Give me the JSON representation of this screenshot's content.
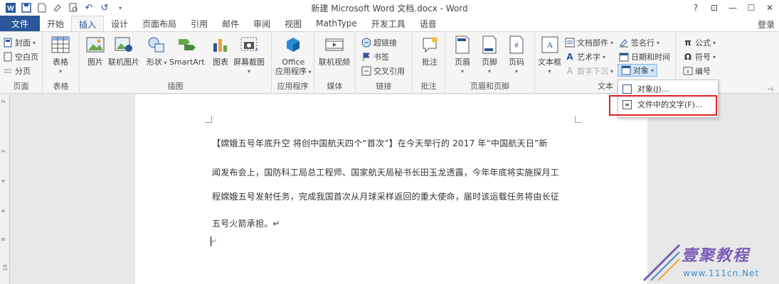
{
  "window": {
    "title": "新建 Microsoft Word 文档.docx - Word",
    "controls": [
      "?",
      "⊡",
      "—",
      "☐",
      "✕"
    ]
  },
  "qat": {
    "save": "💾",
    "undo": "↶",
    "redo": "↺"
  },
  "tabs": [
    "文件",
    "开始",
    "插入",
    "设计",
    "页面布局",
    "引用",
    "邮件",
    "审阅",
    "视图",
    "MathType",
    "开发工具",
    "语音"
  ],
  "active_tab": "插入",
  "login": "登录",
  "ribbon": {
    "pages": {
      "label": "页面",
      "cover": "封面",
      "blank": "空白页",
      "break": "分页"
    },
    "tables": {
      "label": "表格",
      "table": "表格"
    },
    "illustrations": {
      "label": "插图",
      "picture": "图片",
      "online_picture": "联机图片",
      "shapes": "形状",
      "smartart": "SmartArt",
      "chart": "图表",
      "screenshot": "屏幕截图"
    },
    "apps": {
      "label": "应用程序",
      "office_apps_1": "Office",
      "office_apps_2": "应用程序"
    },
    "media": {
      "label": "媒体",
      "online_video": "联机视频"
    },
    "links": {
      "label": "链接",
      "hyperlink": "超链接",
      "bookmark": "书签",
      "cross_ref": "交叉引用"
    },
    "comments": {
      "label": "批注",
      "comment": "批注"
    },
    "header_footer": {
      "label": "页眉和页脚",
      "header": "页眉",
      "footer": "页脚",
      "page_number": "页码"
    },
    "text": {
      "label": "文本",
      "textbox": "文本框",
      "quick_parts": "文档部件",
      "wordart": "艺术字",
      "dropcap": "首字下沉",
      "signature": "签名行",
      "datetime": "日期和时间",
      "object": "对象"
    },
    "symbols": {
      "formula": "公式",
      "symbol": "符号",
      "number": "编号"
    }
  },
  "menu": {
    "item1": "对象(J)...",
    "item2": "文件中的文字(F)..."
  },
  "document": {
    "lines": [
      "【嫦娥五号年底升空 将创中国航天四个“首次”】在今天举行的 2017 年“中国航天日”新",
      "闻发布会上，国防科工局总工程师、国家航天局秘书长田玉龙透露，今年年底将实施探月工",
      "程嫦娥五号发射任务，完成我国首次从月球采样返回的重大使命，届时该运载任务将由长征",
      "五号火箭承担。↵"
    ],
    "cursor_mark": "↵"
  },
  "ruler_numbers": [
    "2",
    "2",
    "4",
    "6",
    "8",
    "10"
  ],
  "watermark": {
    "brand": "壹聚教程",
    "url": "www.111cn.Net"
  },
  "colors": {
    "accent": "#2b579a",
    "highlight": "#e02020"
  }
}
